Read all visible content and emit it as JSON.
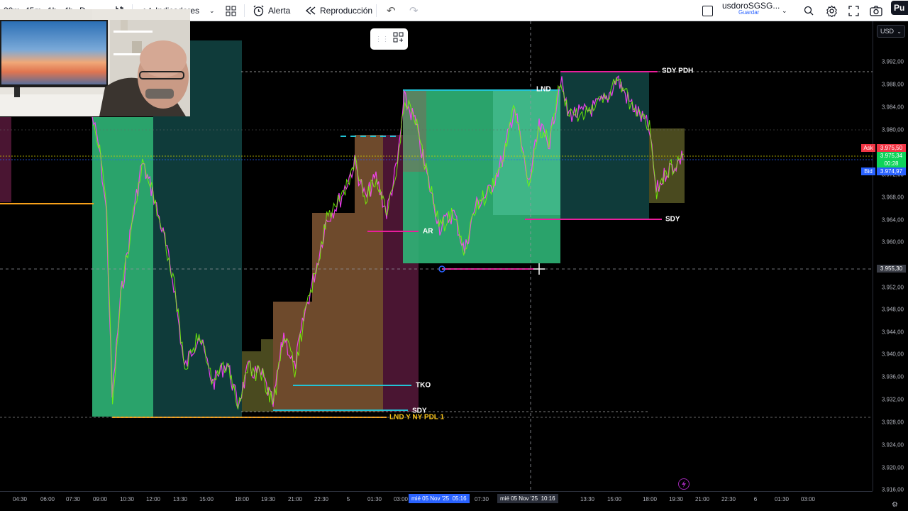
{
  "toolbar": {
    "timeframes": [
      "30m",
      "45m",
      "1h",
      "4h",
      "D"
    ],
    "indicators_label": "Indicadores",
    "alert_label": "Alerta",
    "replay_label": "Reproducción",
    "layout_name": "usdoroSGSG...",
    "save_label": "Guardar",
    "publish_label": "Pu"
  },
  "price_axis": {
    "currency": "USD",
    "ticks": [
      "3.992,00",
      "3.988,00",
      "3.984,00",
      "3.980,00",
      "3.976,00",
      "3.972,00",
      "3.968,00",
      "3.964,00",
      "3.960,00",
      "3.956,00",
      "3.952,00",
      "3.948,00",
      "3.944,00",
      "3.940,00",
      "3.936,00",
      "3.932,00",
      "3.928,00",
      "3.924,00",
      "3.920,00",
      "3.916,00"
    ],
    "ask_label": "Ask",
    "ask_price": "3.975,50",
    "last_price": "3.975,34",
    "countdown": "00:28",
    "bid_label": "Bid",
    "bid_price": "3.974,97",
    "crosshair_price": "3.955,30"
  },
  "time_axis": {
    "ticks": [
      "04:30",
      "06:00",
      "07:30",
      "09:00",
      "10:30",
      "12:00",
      "13:30",
      "15:00",
      "18:00",
      "19:30",
      "21:00",
      "22:30",
      "5",
      "01:30",
      "03:00",
      "07:30",
      "13:30",
      "15:00",
      "18:00",
      "19:30",
      "21:00",
      "22:30",
      "6",
      "01:30",
      "03:00"
    ],
    "highlight_1_date": "mié 05 Nov '25",
    "highlight_1_time": "05:16",
    "highlight_2_date": "mié 05 Nov '25",
    "highlight_2_time": "10:16"
  },
  "chart_labels": {
    "sdy_pdh": "SDY PDH",
    "lnd": "LND",
    "ar": "AR",
    "sdy_mid": "SDY",
    "tko": "TKO",
    "sdy_low": "SDY",
    "lnd_ny_pdl": "LND Y NY PDL  1"
  },
  "colors": {
    "background": "#000000",
    "session_green": "#2fb577",
    "session_teal": "#0f3b3a",
    "session_brown": "#6e4a2c",
    "session_maroon": "#4a1532",
    "session_olive": "#4a4a1f",
    "level_magenta": "#e91e9c",
    "level_cyan": "#22c3d6",
    "level_orange": "#f7a11a",
    "candle_green": "#76ff03",
    "candle_pink": "#ff40ff",
    "ask_red": "#f23645",
    "bid_blue": "#2962ff"
  }
}
